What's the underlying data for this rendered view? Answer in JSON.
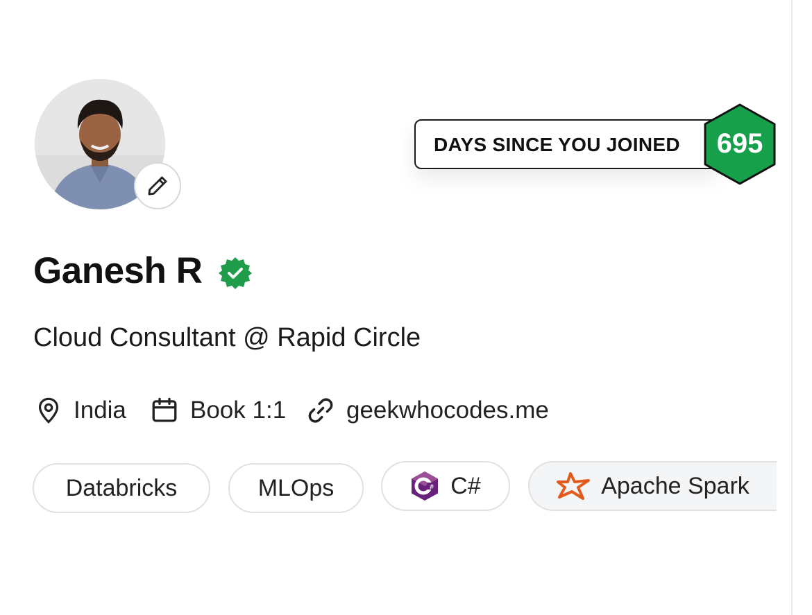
{
  "profile": {
    "name": "Ganesh R",
    "headline": "Cloud Consultant @ Rapid Circle",
    "location": "India",
    "booking_label": "Book 1:1",
    "website": "geekwhocodes.me"
  },
  "stats": {
    "days_label": "DAYS SINCE YOU JOINED",
    "days_count": "695"
  },
  "skills": [
    {
      "label": "Databricks",
      "icon": ""
    },
    {
      "label": "MLOps",
      "icon": ""
    },
    {
      "label": "C#",
      "icon": "csharp-icon"
    },
    {
      "label": "Apache Spark",
      "icon": "apache-spark-icon"
    }
  ],
  "colors": {
    "verified_green": "#1f9d4b",
    "hex_green": "#17a04a",
    "csharp_purple": "#68217a",
    "spark_orange": "#e25a1c"
  }
}
